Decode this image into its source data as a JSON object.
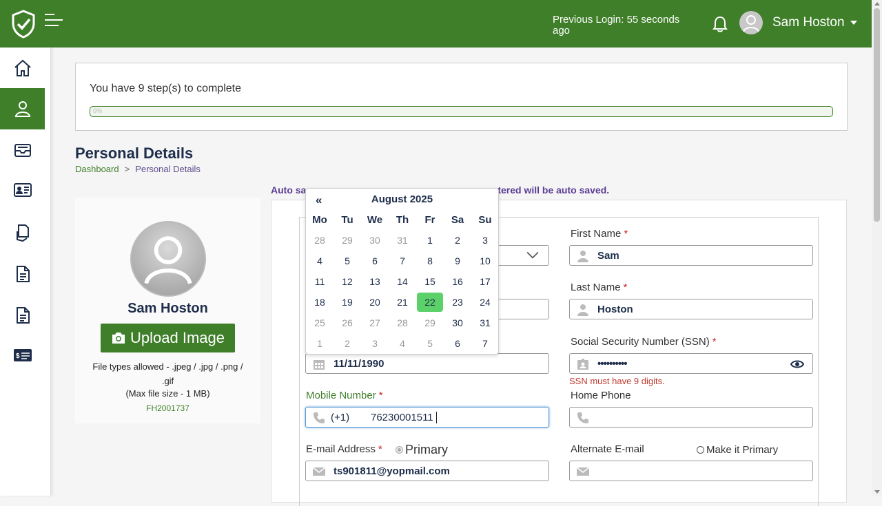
{
  "header": {
    "previous_login": "Previous Login: 55 seconds ago",
    "user_name": "Sam Hoston"
  },
  "sidebar": {
    "items": [
      {
        "icon": "home-icon"
      },
      {
        "icon": "user-icon",
        "active": true
      },
      {
        "icon": "inbox-icon"
      },
      {
        "icon": "id-card-icon"
      },
      {
        "icon": "hand-document-icon"
      },
      {
        "icon": "document-icon"
      },
      {
        "icon": "document-list-icon"
      },
      {
        "icon": "payment-icon"
      }
    ]
  },
  "steps": {
    "text": "You have 9 step(s) to complete",
    "progress_label": "0%",
    "progress": 0
  },
  "page": {
    "title": "Personal Details",
    "breadcrumb_home": "Dashboard",
    "breadcrumb_sep": ">",
    "breadcrumb_current": "Personal Details",
    "autosave_visible_start": "Auto sa",
    "autosave_visible_end": "tered will be auto saved."
  },
  "profile": {
    "name": "Sam Hoston",
    "upload_label": "Upload Image",
    "file_types": "File types allowed - .jpeg / .jpg / .png / .gif",
    "max_size": "(Max file size - 1 MB)",
    "id": "FH2001737"
  },
  "form": {
    "first_name_label": "First Name",
    "first_name_value": "Sam",
    "last_name_label": "Last Name",
    "last_name_value": "Hoston",
    "dob_value": "11/11/1990",
    "ssn_label": "Social Security Number (SSN)",
    "ssn_value": "••••••••••",
    "ssn_error": "SSN must have 9 digits.",
    "mobile_label": "Mobile Number",
    "mobile_prefix": "(+1)",
    "mobile_value": "76230001511",
    "home_phone_label": "Home Phone",
    "email_label": "E-mail Address",
    "primary_label": "Primary",
    "email_value": "ts901811@yopmail.com",
    "alt_email_label": "Alternate E-mail",
    "make_primary_label": "Make it Primary",
    "required_mark": "*"
  },
  "calendar": {
    "prev": "«",
    "title": "August 2025",
    "weekdays": [
      "Mo",
      "Tu",
      "We",
      "Th",
      "Fr",
      "Sa",
      "Su"
    ],
    "days": [
      [
        "28",
        "29",
        "30",
        "31",
        "1",
        "2",
        "3"
      ],
      [
        "4",
        "5",
        "6",
        "7",
        "8",
        "9",
        "10"
      ],
      [
        "11",
        "12",
        "13",
        "14",
        "15",
        "16",
        "17"
      ],
      [
        "18",
        "19",
        "20",
        "21",
        "22",
        "23",
        "24"
      ],
      [
        "25",
        "26",
        "27",
        "28",
        "29",
        "30",
        "31"
      ],
      [
        "1",
        "2",
        "3",
        "4",
        "5",
        "6",
        "7"
      ]
    ],
    "selected": "22",
    "colors": {
      "selected": "#5cd16a",
      "accent": "#3f7f2a"
    }
  }
}
